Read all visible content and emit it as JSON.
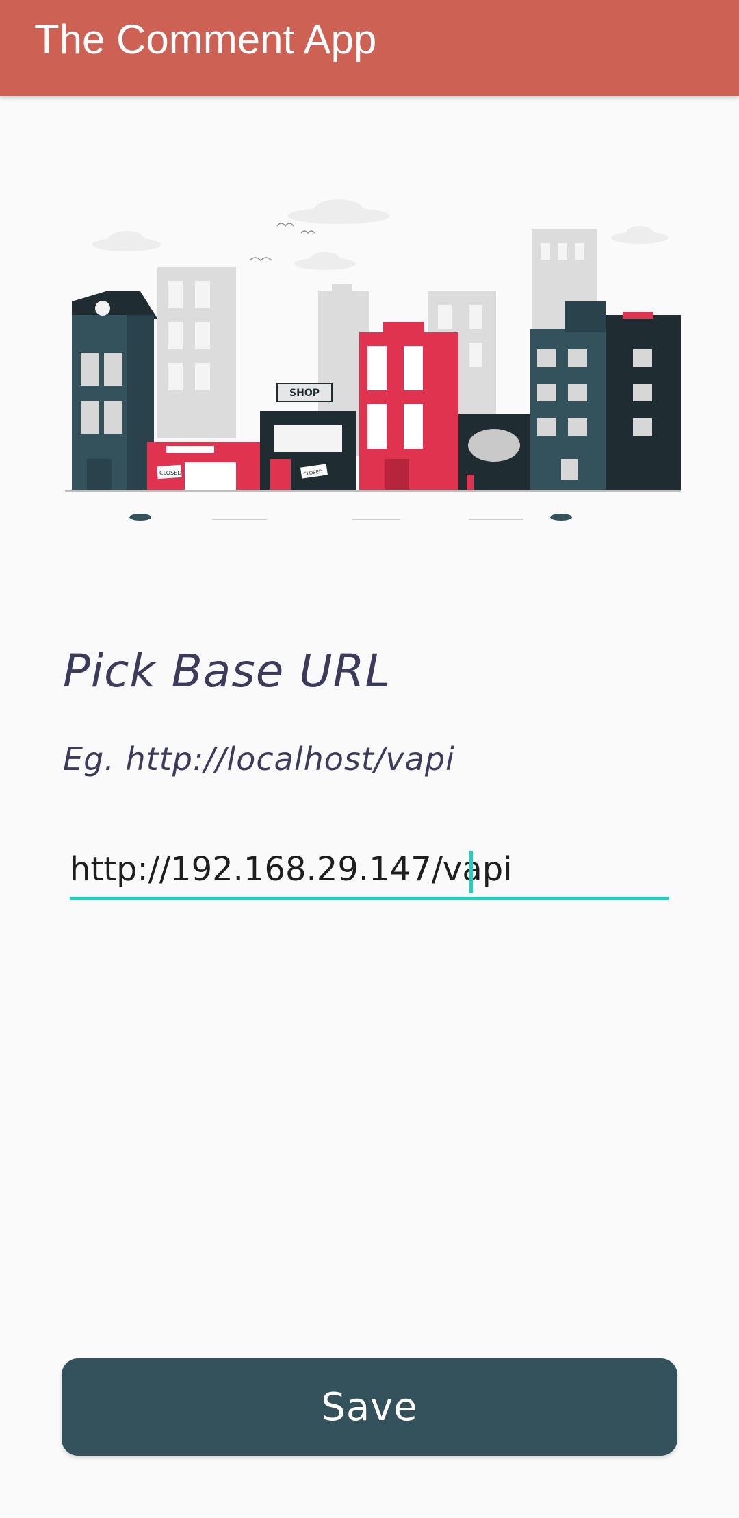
{
  "app_bar": {
    "title": "The Comment App",
    "color": "#CD6154"
  },
  "illustration": {
    "description": "city-street-buildings",
    "shop_sign": "SHOP",
    "closed_sign": "CLOSED"
  },
  "form": {
    "heading": "Pick Base URL",
    "hint": "Eg. http://localhost/vapi",
    "url_value": "http://192.168.29.147/vapi",
    "accent_color": "#1FCFC3"
  },
  "save_button": {
    "label": "Save",
    "color": "#34525C"
  }
}
